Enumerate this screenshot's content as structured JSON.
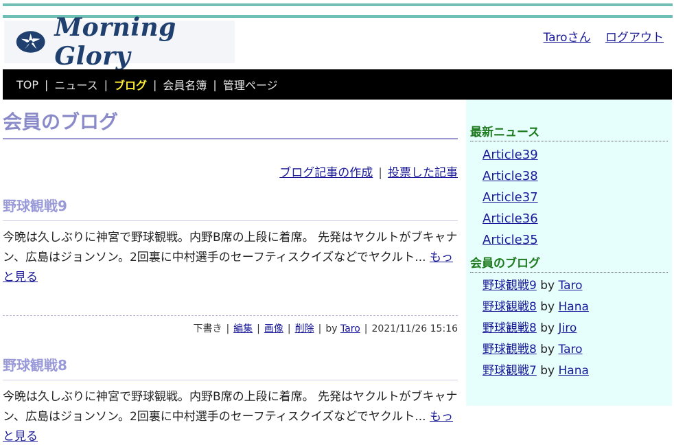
{
  "header": {
    "logo_text": "Morning Glory",
    "user_link": "Taroさん",
    "logout_link": "ログアウト"
  },
  "nav": {
    "items": [
      "TOP",
      "ニュース",
      "ブログ",
      "会員名簿",
      "管理ページ"
    ],
    "active": "ブログ",
    "separator": "|"
  },
  "main": {
    "title": "会員のブログ",
    "actions": {
      "create": "ブログ記事の作成",
      "voted": "投票した記事",
      "separator": "|"
    },
    "posts": [
      {
        "title": "野球観戦9",
        "body": "今晩は久しぶりに神宮で野球観戦。内野B席の上段に着席。 先発はヤクルトがブキャナン、広島はジョンソン。2回裏に中村選手のセーフティスクイズなどでヤクルト...",
        "more": "もっと見る",
        "meta": {
          "status": "下書き",
          "edit": "編集",
          "image": "画像",
          "delete": "削除",
          "by": "by",
          "author": "Taro",
          "datetime": "2021/11/26 15:16"
        }
      },
      {
        "title": "野球観戦8",
        "body": "今晩は久しぶりに神宮で野球観戦。内野B席の上段に着席。 先発はヤクルトがブキャナン、広島はジョンソン。2回裏に中村選手のセーフティスクイズなどでヤクルト...",
        "more": "もっと見る"
      }
    ]
  },
  "sidebar": {
    "news_heading": "最新ニュース",
    "news": [
      "Article39",
      "Article38",
      "Article37",
      "Article36",
      "Article35"
    ],
    "blog_heading": "会員のブログ",
    "blogs": [
      {
        "title": "野球観戦9",
        "by": "by",
        "author": "Taro"
      },
      {
        "title": "野球観戦8",
        "by": "by",
        "author": "Hana"
      },
      {
        "title": "野球観戦8",
        "by": "by",
        "author": "Jiro"
      },
      {
        "title": "野球観戦8",
        "by": "by",
        "author": "Taro"
      },
      {
        "title": "野球観戦7",
        "by": "by",
        "author": "Hana"
      }
    ]
  },
  "colors": {
    "accent_bar": "#6fbfb6",
    "nav_bg": "#000000",
    "nav_active": "#ffee33",
    "title": "#8a8ac9",
    "sidebar_bg": "#e6fffc",
    "sidebar_heading": "#1e7a1e",
    "link": "#1a1a99"
  }
}
